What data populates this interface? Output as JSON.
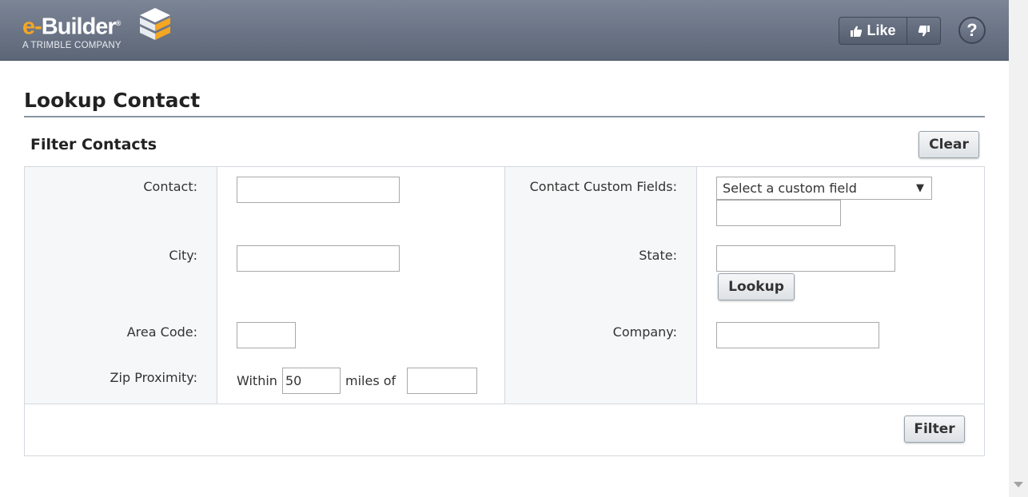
{
  "header": {
    "logo_main_orange": "e-",
    "logo_main_white": "Builder",
    "logo_registered": "®",
    "logo_sub": "A TRIMBLE COMPANY",
    "like_label": "Like",
    "help_label": "?"
  },
  "page": {
    "title": "Lookup Contact",
    "section_title": "Filter Contacts",
    "clear_label": "Clear",
    "filter_label": "Filter"
  },
  "form": {
    "contact_label": "Contact:",
    "contact_value": "",
    "city_label": "City:",
    "city_value": "",
    "area_code_label": "Area Code:",
    "area_code_value": "",
    "zip_label": "Zip Proximity:",
    "within_label": "Within",
    "miles_value": "50",
    "miles_of_label": "miles of",
    "zip_value": "",
    "custom_fields_label": "Contact Custom Fields:",
    "custom_field_selected": "Select a custom field",
    "custom_field_value": "",
    "state_label": "State:",
    "state_value": "",
    "lookup_label": "Lookup",
    "company_label": "Company:",
    "company_value": ""
  },
  "colors": {
    "brand_orange": "#f5a623",
    "header_bg": "#6b7486"
  }
}
